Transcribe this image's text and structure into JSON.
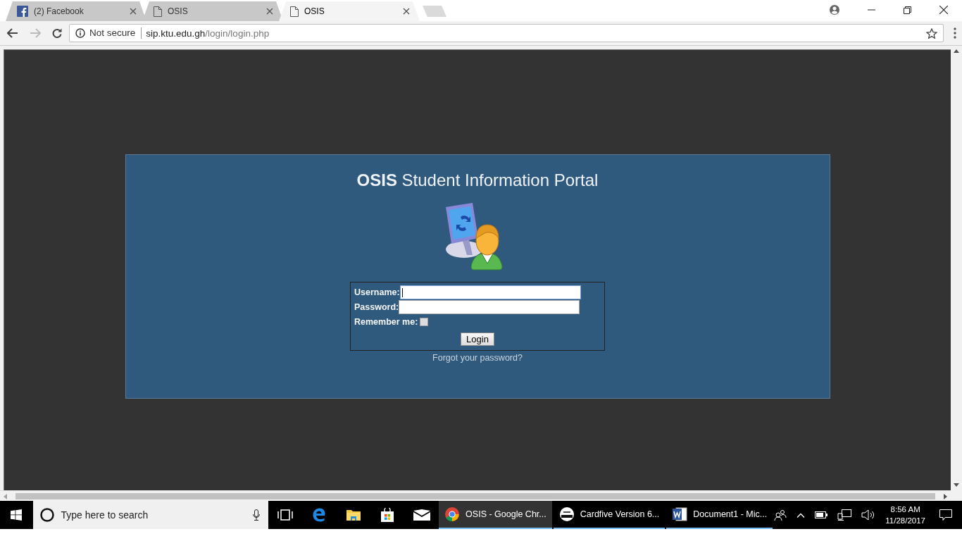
{
  "browser": {
    "tabs": [
      {
        "title": "(2) Facebook",
        "selected": false
      },
      {
        "title": "OSIS",
        "selected": false
      },
      {
        "title": "OSIS",
        "selected": true
      }
    ],
    "address_bar": {
      "security": "Not secure",
      "url_host": "sip.ktu.edu.gh",
      "url_path": "/login/login.php"
    }
  },
  "login": {
    "title": "**OSIS** Student Information Portal",
    "fields": [
      {
        "label": "Username:",
        "focused": true
      },
      {
        "label": "Password:",
        "focused": false
      }
    ],
    "remember": {
      "label": "Remember me:",
      "checked": false
    },
    "button": "Login",
    "forgot_link": "Forgot your password?"
  },
  "taskbar": {
    "search_placeholder": "Type here to search",
    "apps": [
      {
        "label": "OSIS - Google Chr...",
        "selected": true
      },
      {
        "label": "Cardfive Version 6...",
        "selected": false
      },
      {
        "label": "Document1 - Mic...",
        "selected": false
      }
    ],
    "time": "8:56 AM",
    "date": "11/28/2017"
  }
}
